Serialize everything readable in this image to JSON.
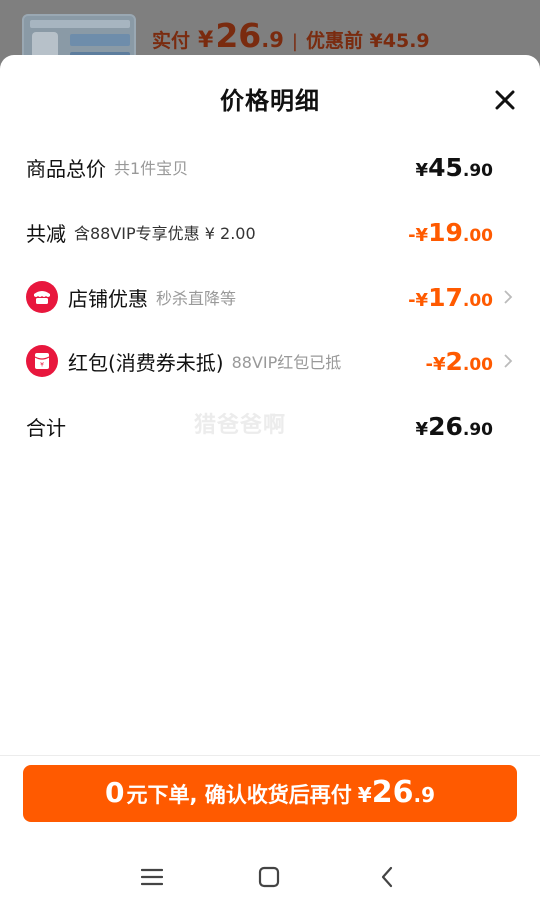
{
  "background": {
    "paid_label": "实付",
    "paid_currency": "¥",
    "paid_int": "26",
    "paid_dec": ".9",
    "separator": "|",
    "original_label": "优惠前 ¥45.9"
  },
  "sheet": {
    "title": "价格明细",
    "close_icon": "close-icon"
  },
  "rows": {
    "total": {
      "label": "商品总价",
      "sub": "共1件宝贝",
      "currency": "¥",
      "int": "45",
      "dec": ".90"
    },
    "discount": {
      "label": "共减",
      "sub": "含88VIP专享优惠 ¥ 2.00",
      "currency": "-¥",
      "int": "19",
      "dec": ".00"
    },
    "shop": {
      "icon": "shop-icon",
      "label": "店铺优惠",
      "sub": "秒杀直降等",
      "currency": "-¥",
      "int": "17",
      "dec": ".00"
    },
    "redpacket": {
      "icon": "red-packet-icon",
      "label": "红包(消费券未抵)",
      "sub": "88VIP红包已抵",
      "currency": "-¥",
      "int": "2",
      "dec": ".00"
    },
    "sum": {
      "label": "合计",
      "currency": "¥",
      "int": "26",
      "dec": ".90"
    }
  },
  "watermark": "猎爸爸啊",
  "cta": {
    "zero": "0",
    "text": "元下单, 确认收货后再付",
    "currency": "¥",
    "int": "26",
    "dec": ".9"
  },
  "colors": {
    "accent": "#ff5a00",
    "icon_red": "#e8173d"
  },
  "navbar": {
    "menu_icon": "menu-icon",
    "home_icon": "home-icon",
    "back_icon": "back-icon"
  }
}
